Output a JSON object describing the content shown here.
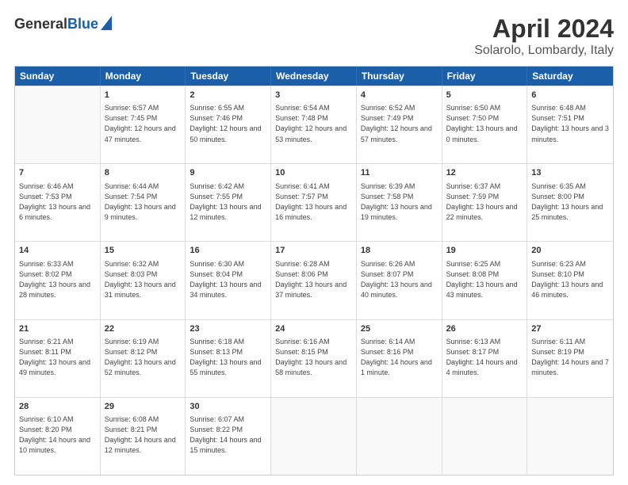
{
  "header": {
    "logo_general": "General",
    "logo_blue": "Blue",
    "month_title": "April 2024",
    "subtitle": "Solarolo, Lombardy, Italy"
  },
  "weekdays": [
    "Sunday",
    "Monday",
    "Tuesday",
    "Wednesday",
    "Thursday",
    "Friday",
    "Saturday"
  ],
  "rows": [
    [
      {
        "day": "",
        "sunrise": "",
        "sunset": "",
        "daylight": ""
      },
      {
        "day": "1",
        "sunrise": "Sunrise: 6:57 AM",
        "sunset": "Sunset: 7:45 PM",
        "daylight": "Daylight: 12 hours and 47 minutes."
      },
      {
        "day": "2",
        "sunrise": "Sunrise: 6:55 AM",
        "sunset": "Sunset: 7:46 PM",
        "daylight": "Daylight: 12 hours and 50 minutes."
      },
      {
        "day": "3",
        "sunrise": "Sunrise: 6:54 AM",
        "sunset": "Sunset: 7:48 PM",
        "daylight": "Daylight: 12 hours and 53 minutes."
      },
      {
        "day": "4",
        "sunrise": "Sunrise: 6:52 AM",
        "sunset": "Sunset: 7:49 PM",
        "daylight": "Daylight: 12 hours and 57 minutes."
      },
      {
        "day": "5",
        "sunrise": "Sunrise: 6:50 AM",
        "sunset": "Sunset: 7:50 PM",
        "daylight": "Daylight: 13 hours and 0 minutes."
      },
      {
        "day": "6",
        "sunrise": "Sunrise: 6:48 AM",
        "sunset": "Sunset: 7:51 PM",
        "daylight": "Daylight: 13 hours and 3 minutes."
      }
    ],
    [
      {
        "day": "7",
        "sunrise": "Sunrise: 6:46 AM",
        "sunset": "Sunset: 7:53 PM",
        "daylight": "Daylight: 13 hours and 6 minutes."
      },
      {
        "day": "8",
        "sunrise": "Sunrise: 6:44 AM",
        "sunset": "Sunset: 7:54 PM",
        "daylight": "Daylight: 13 hours and 9 minutes."
      },
      {
        "day": "9",
        "sunrise": "Sunrise: 6:42 AM",
        "sunset": "Sunset: 7:55 PM",
        "daylight": "Daylight: 13 hours and 12 minutes."
      },
      {
        "day": "10",
        "sunrise": "Sunrise: 6:41 AM",
        "sunset": "Sunset: 7:57 PM",
        "daylight": "Daylight: 13 hours and 16 minutes."
      },
      {
        "day": "11",
        "sunrise": "Sunrise: 6:39 AM",
        "sunset": "Sunset: 7:58 PM",
        "daylight": "Daylight: 13 hours and 19 minutes."
      },
      {
        "day": "12",
        "sunrise": "Sunrise: 6:37 AM",
        "sunset": "Sunset: 7:59 PM",
        "daylight": "Daylight: 13 hours and 22 minutes."
      },
      {
        "day": "13",
        "sunrise": "Sunrise: 6:35 AM",
        "sunset": "Sunset: 8:00 PM",
        "daylight": "Daylight: 13 hours and 25 minutes."
      }
    ],
    [
      {
        "day": "14",
        "sunrise": "Sunrise: 6:33 AM",
        "sunset": "Sunset: 8:02 PM",
        "daylight": "Daylight: 13 hours and 28 minutes."
      },
      {
        "day": "15",
        "sunrise": "Sunrise: 6:32 AM",
        "sunset": "Sunset: 8:03 PM",
        "daylight": "Daylight: 13 hours and 31 minutes."
      },
      {
        "day": "16",
        "sunrise": "Sunrise: 6:30 AM",
        "sunset": "Sunset: 8:04 PM",
        "daylight": "Daylight: 13 hours and 34 minutes."
      },
      {
        "day": "17",
        "sunrise": "Sunrise: 6:28 AM",
        "sunset": "Sunset: 8:06 PM",
        "daylight": "Daylight: 13 hours and 37 minutes."
      },
      {
        "day": "18",
        "sunrise": "Sunrise: 6:26 AM",
        "sunset": "Sunset: 8:07 PM",
        "daylight": "Daylight: 13 hours and 40 minutes."
      },
      {
        "day": "19",
        "sunrise": "Sunrise: 6:25 AM",
        "sunset": "Sunset: 8:08 PM",
        "daylight": "Daylight: 13 hours and 43 minutes."
      },
      {
        "day": "20",
        "sunrise": "Sunrise: 6:23 AM",
        "sunset": "Sunset: 8:10 PM",
        "daylight": "Daylight: 13 hours and 46 minutes."
      }
    ],
    [
      {
        "day": "21",
        "sunrise": "Sunrise: 6:21 AM",
        "sunset": "Sunset: 8:11 PM",
        "daylight": "Daylight: 13 hours and 49 minutes."
      },
      {
        "day": "22",
        "sunrise": "Sunrise: 6:19 AM",
        "sunset": "Sunset: 8:12 PM",
        "daylight": "Daylight: 13 hours and 52 minutes."
      },
      {
        "day": "23",
        "sunrise": "Sunrise: 6:18 AM",
        "sunset": "Sunset: 8:13 PM",
        "daylight": "Daylight: 13 hours and 55 minutes."
      },
      {
        "day": "24",
        "sunrise": "Sunrise: 6:16 AM",
        "sunset": "Sunset: 8:15 PM",
        "daylight": "Daylight: 13 hours and 58 minutes."
      },
      {
        "day": "25",
        "sunrise": "Sunrise: 6:14 AM",
        "sunset": "Sunset: 8:16 PM",
        "daylight": "Daylight: 14 hours and 1 minute."
      },
      {
        "day": "26",
        "sunrise": "Sunrise: 6:13 AM",
        "sunset": "Sunset: 8:17 PM",
        "daylight": "Daylight: 14 hours and 4 minutes."
      },
      {
        "day": "27",
        "sunrise": "Sunrise: 6:11 AM",
        "sunset": "Sunset: 8:19 PM",
        "daylight": "Daylight: 14 hours and 7 minutes."
      }
    ],
    [
      {
        "day": "28",
        "sunrise": "Sunrise: 6:10 AM",
        "sunset": "Sunset: 8:20 PM",
        "daylight": "Daylight: 14 hours and 10 minutes."
      },
      {
        "day": "29",
        "sunrise": "Sunrise: 6:08 AM",
        "sunset": "Sunset: 8:21 PM",
        "daylight": "Daylight: 14 hours and 12 minutes."
      },
      {
        "day": "30",
        "sunrise": "Sunrise: 6:07 AM",
        "sunset": "Sunset: 8:22 PM",
        "daylight": "Daylight: 14 hours and 15 minutes."
      },
      {
        "day": "",
        "sunrise": "",
        "sunset": "",
        "daylight": ""
      },
      {
        "day": "",
        "sunrise": "",
        "sunset": "",
        "daylight": ""
      },
      {
        "day": "",
        "sunrise": "",
        "sunset": "",
        "daylight": ""
      },
      {
        "day": "",
        "sunrise": "",
        "sunset": "",
        "daylight": ""
      }
    ]
  ]
}
